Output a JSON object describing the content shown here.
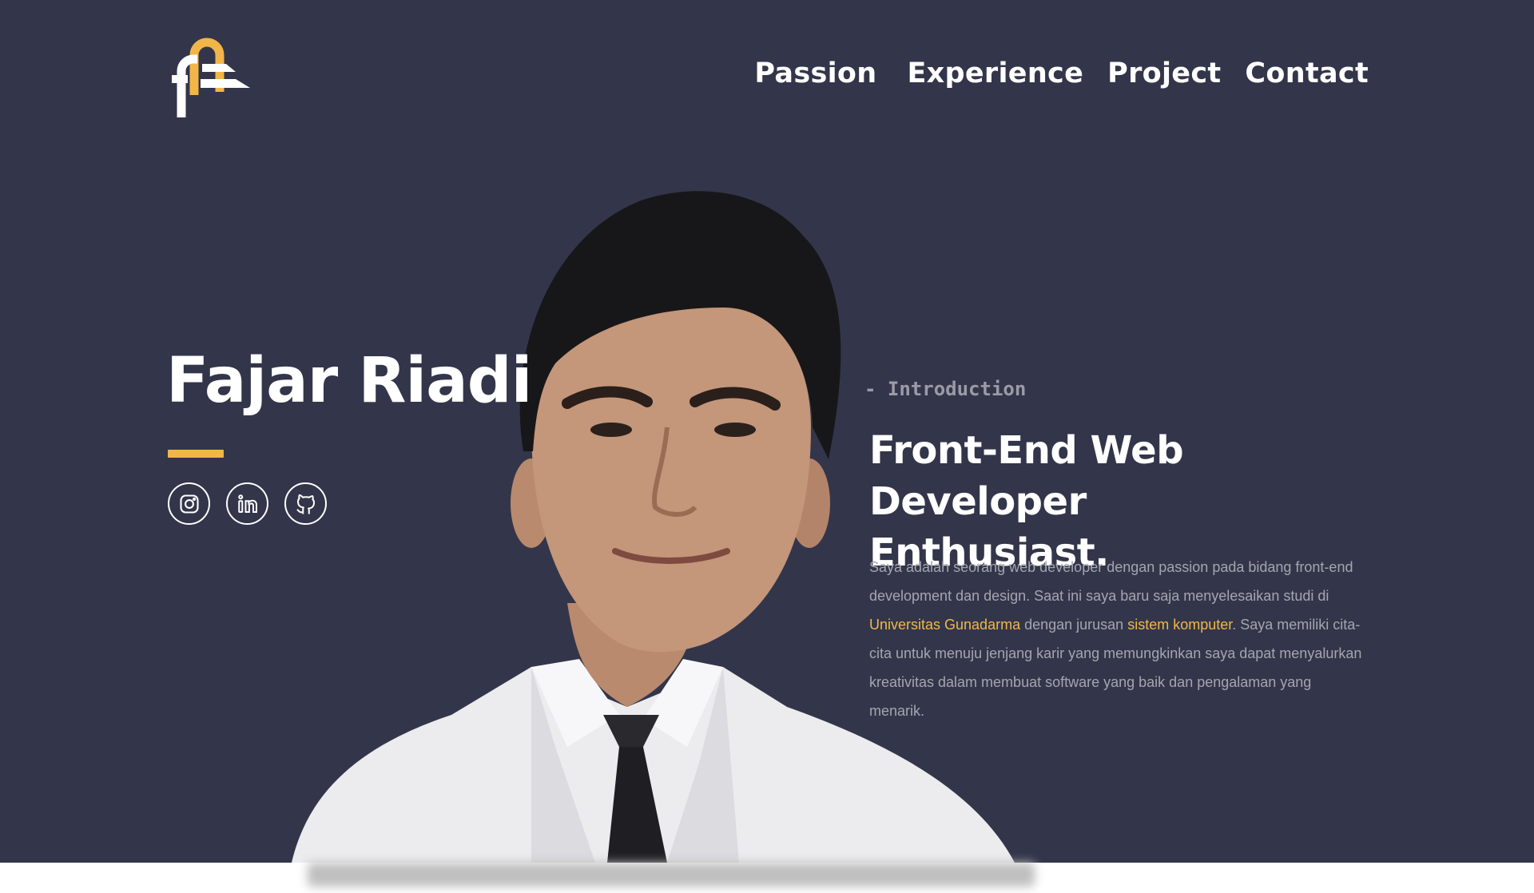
{
  "nav": {
    "items": [
      {
        "label": "Passion"
      },
      {
        "label": "Experience"
      },
      {
        "label": "Project"
      },
      {
        "label": "Contact"
      }
    ]
  },
  "hero": {
    "name": "Fajar Riadi",
    "intro_label": "- Introduction",
    "headline_line1": "Front-End Web Developer",
    "headline_line2": "Enthusiast.",
    "bio": {
      "part1": "Saya adalah seorang web developer dengan passion pada bidang front-end development dan design. Saat ini saya baru saja menyelesaikan studi di ",
      "university": "Universitas Gunadarma",
      "part2": " dengan jurusan ",
      "major": "sistem komputer",
      "part3": ". Saya memiliki cita-cita untuk menuju jenjang karir yang memungkinkan saya dapat menyalurkan kreativitas dalam membuat software yang baik dan pengalaman yang menarik."
    }
  },
  "socials": [
    {
      "icon": "instagram-icon"
    },
    {
      "icon": "linkedin-icon"
    },
    {
      "icon": "github-icon"
    }
  ],
  "colors": {
    "background": "#33364a",
    "accent": "#f2b648",
    "text": "#ffffff",
    "muted": "#a4a5b0"
  }
}
